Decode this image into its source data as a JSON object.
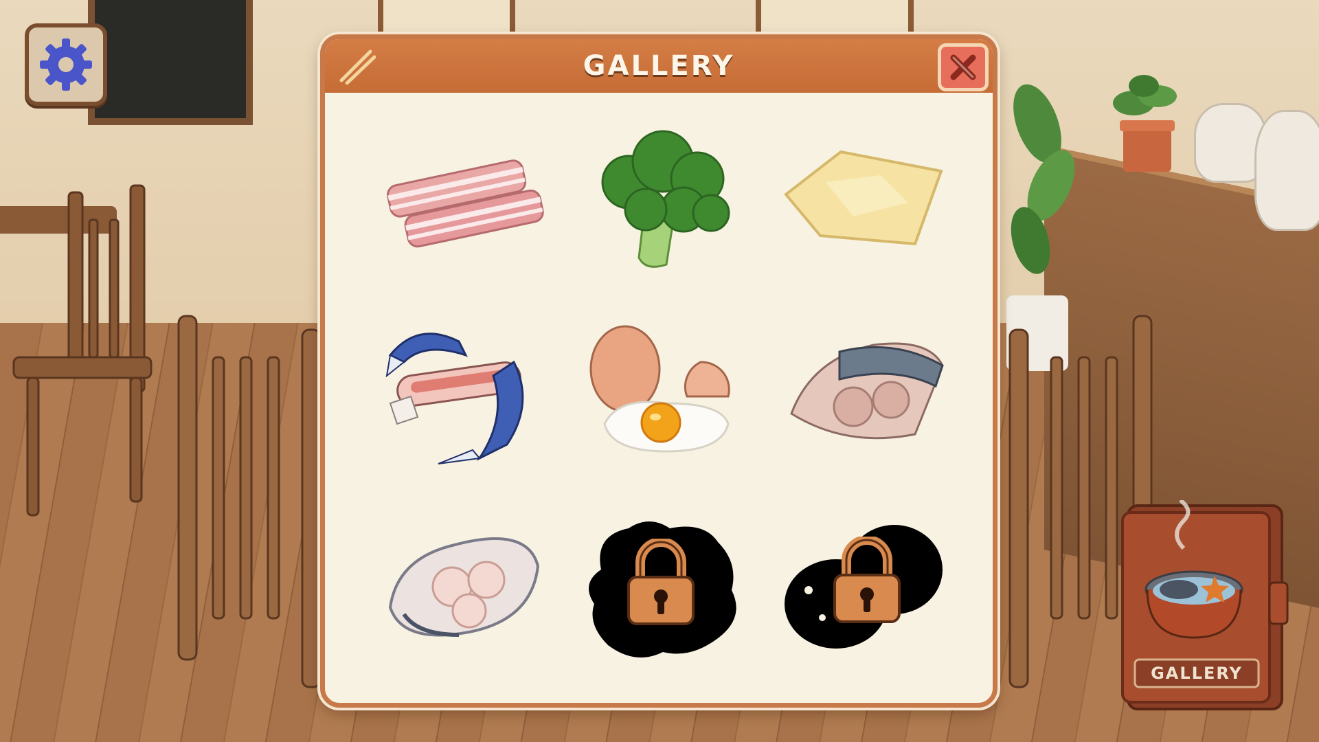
{
  "settings": {
    "icon": "gear-icon"
  },
  "gallery_modal": {
    "title": "GALLERY",
    "close_icon": "close-icon",
    "items": [
      {
        "name": "bacon",
        "locked": false
      },
      {
        "name": "broccoli",
        "locked": false
      },
      {
        "name": "cheese-slice",
        "locked": false
      },
      {
        "name": "crab",
        "locked": false
      },
      {
        "name": "eggs",
        "locked": false
      },
      {
        "name": "mackerel-steak",
        "locked": false
      },
      {
        "name": "fish-steak",
        "locked": false
      },
      {
        "name": "locked-item-1",
        "locked": true
      },
      {
        "name": "locked-item-2",
        "locked": true
      }
    ]
  },
  "gallery_book": {
    "label": "GALLERY"
  },
  "colors": {
    "header": "#c66c36",
    "panel": "#f8f2e2",
    "close": "#e76e5b",
    "gear": "#4a55c9"
  }
}
